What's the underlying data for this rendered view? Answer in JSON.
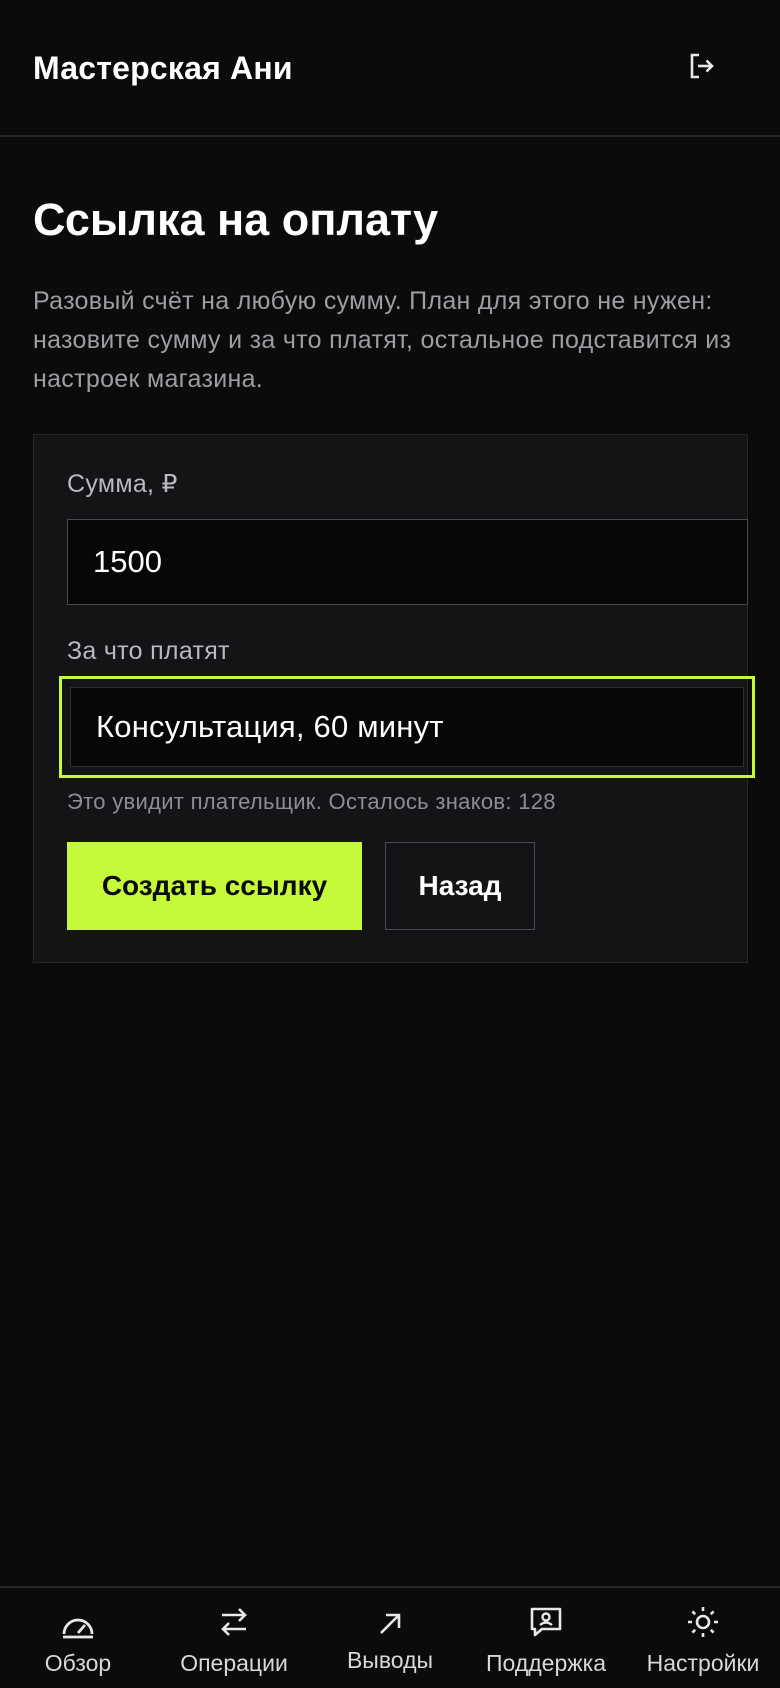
{
  "header": {
    "shop_name": "Мастерская Ани",
    "logout_icon": "logout-icon"
  },
  "page": {
    "title": "Ссылка на оплату",
    "description": "Разовый счёт на любую сумму. План для этого не нужен: назовите сумму и за что платят, остальное подставится из настроек магазина."
  },
  "form": {
    "amount_label": "Сумма, ₽",
    "amount_value": "1500",
    "purpose_label": "За что платят",
    "purpose_value": "Консультация, 60 минут",
    "hint": "Это увидит плательщик. Осталось знаков: 128",
    "submit_label": "Создать ссылку",
    "back_label": "Назад"
  },
  "nav": {
    "items": [
      {
        "label": "Обзор",
        "icon": "gauge-icon"
      },
      {
        "label": "Операции",
        "icon": "arrows-swap-icon"
      },
      {
        "label": "Выводы",
        "icon": "arrow-up-right-icon"
      },
      {
        "label": "Поддержка",
        "icon": "chat-bubble-icon"
      },
      {
        "label": "Настройки",
        "icon": "sun-gear-icon"
      }
    ]
  },
  "colors": {
    "background": "#0b0b0b",
    "card": "#141416",
    "accent": "#c6f93a",
    "muted_text": "#9d9da3"
  }
}
